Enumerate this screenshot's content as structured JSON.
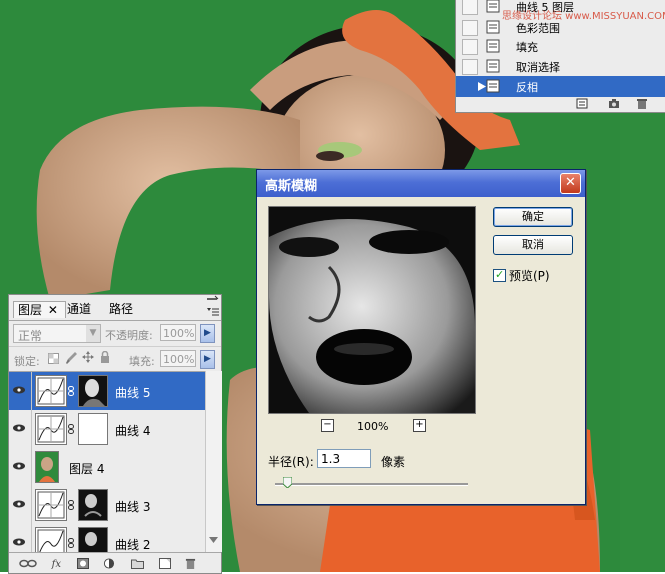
{
  "history": {
    "items": [
      {
        "label": "曲线 5 图层",
        "selected": false
      },
      {
        "label": "色彩范围",
        "selected": false
      },
      {
        "label": "填充",
        "selected": false
      },
      {
        "label": "取消选择",
        "selected": false
      },
      {
        "label": "反相",
        "selected": true
      }
    ],
    "watermark": "思缘设计论坛 www.MISSYUAN.COM"
  },
  "dialog": {
    "title": "高斯模糊",
    "close_glyph": "✕",
    "ok_label": "确定",
    "cancel_label": "取消",
    "preview_label": "预览(P)",
    "preview_checked": true,
    "zoom_minus": "−",
    "zoom_plus": "+",
    "zoom_level": "100%",
    "radius_label": "半径(R):",
    "radius_value": "1.3",
    "radius_unit": "像素"
  },
  "layers_panel": {
    "tabs": [
      {
        "label": "图层",
        "active": true
      },
      {
        "label": "通道",
        "active": false
      },
      {
        "label": "路径",
        "active": false
      }
    ],
    "tab_close": "✕",
    "blend_mode": "正常",
    "opacity_label": "不透明度:",
    "opacity_value": "100%",
    "lock_label": "锁定:",
    "fill_label": "填充:",
    "fill_value": "100%",
    "layers": [
      {
        "name": "曲线 5",
        "type": "curves",
        "mask": "face",
        "selected": true
      },
      {
        "name": "曲线 4",
        "type": "curves",
        "mask": "white",
        "selected": false
      },
      {
        "name": "图层 4",
        "type": "photo",
        "selected": false
      },
      {
        "name": "曲线 3",
        "type": "curves",
        "mask": "face",
        "selected": false
      },
      {
        "name": "曲线 2",
        "type": "curves",
        "mask": "face",
        "selected": false
      }
    ]
  },
  "colors": {
    "background_green": "#2d8a3c",
    "selection_blue": "#316ac5",
    "dialog_face": "#ece9d8"
  }
}
